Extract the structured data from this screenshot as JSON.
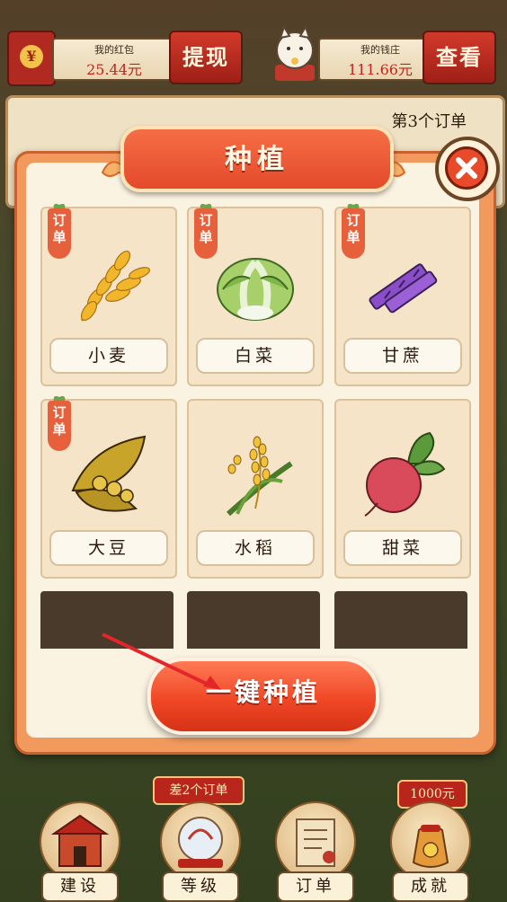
{
  "top_bar": {
    "red_packet": {
      "label": "我的红包",
      "value": "25.44元",
      "icon": "red-envelope-icon"
    },
    "withdraw_label": "提现",
    "bank": {
      "label": "我的钱庄",
      "value": "111.66元",
      "icon": "lucky-cat-icon"
    },
    "view_label": "查看"
  },
  "order_strip": {
    "title": "第3个订单"
  },
  "modal": {
    "title": "种植",
    "close_icon": "close-icon",
    "crops": [
      {
        "name": "小麦",
        "tag": "订单",
        "icon": "wheat-icon"
      },
      {
        "name": "白菜",
        "tag": "订单",
        "icon": "cabbage-icon"
      },
      {
        "name": "甘蔗",
        "tag": "订单",
        "icon": "sugarcane-icon"
      },
      {
        "name": "大豆",
        "tag": "订单",
        "icon": "soybean-icon"
      },
      {
        "name": "水稻",
        "tag": "",
        "icon": "rice-icon"
      },
      {
        "name": "甜菜",
        "tag": "",
        "icon": "beet-icon"
      }
    ],
    "plant_all_label": "一键种植"
  },
  "bottom_nav": {
    "items": [
      {
        "label": "建设",
        "icon": "building-icon"
      },
      {
        "label": "等级",
        "icon": "level-icon"
      },
      {
        "label": "订单",
        "icon": "scroll-icon"
      },
      {
        "label": "成就",
        "icon": "money-bag-icon"
      }
    ],
    "order_badge": "差2个订单",
    "reward_badge": "1000元"
  },
  "colors": {
    "accent_red": "#e44a2b",
    "panel_bg": "#fbf3e2",
    "card_bg": "#f5e4c8",
    "tag_orange": "#e6603b"
  }
}
